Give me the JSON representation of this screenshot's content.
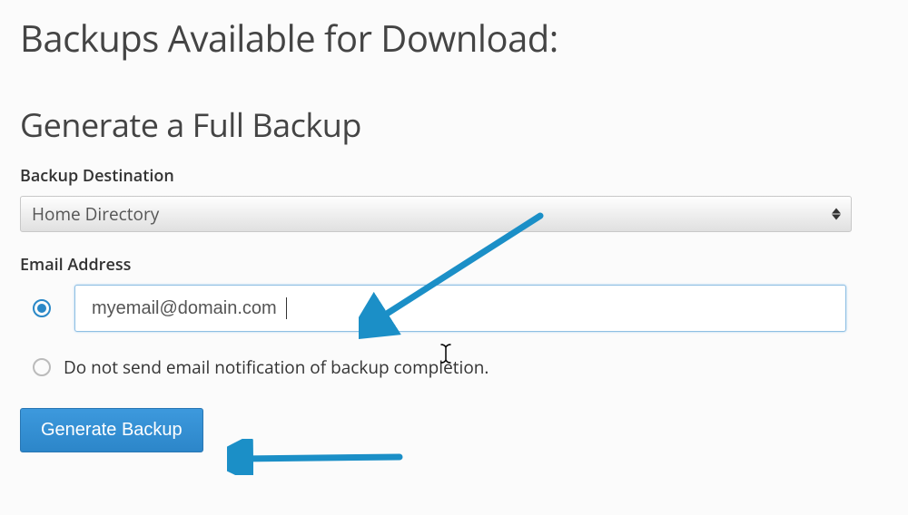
{
  "title": "Backups Available for Download:",
  "section_title": "Generate a Full Backup",
  "labels": {
    "destination": "Backup Destination",
    "email": "Email Address",
    "no_email": "Do not send email notification of backup completion."
  },
  "destination": {
    "selected": "Home Directory"
  },
  "email_input": {
    "value": "myemail@domain.com"
  },
  "button": {
    "generate": "Generate Backup"
  }
}
